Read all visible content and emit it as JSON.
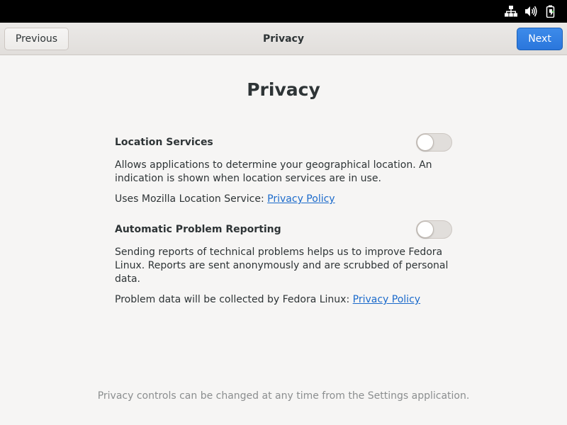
{
  "tray": {
    "icons": [
      "network-wired-icon",
      "volume-icon",
      "battery-charging-icon"
    ]
  },
  "header": {
    "title": "Privacy",
    "previous_label": "Previous",
    "next_label": "Next"
  },
  "main": {
    "title": "Privacy",
    "sections": [
      {
        "label": "Location Services",
        "enabled": false,
        "description": "Allows applications to determine your geographical location. An indication is shown when location services are in use.",
        "policy_prefix": "Uses Mozilla Location Service:",
        "policy_link": "Privacy Policy"
      },
      {
        "label": "Automatic Problem Reporting",
        "enabled": false,
        "description": "Sending reports of technical problems helps us to improve Fedora Linux. Reports are sent anonymously and are scrubbed of personal data.",
        "policy_prefix": "Problem data will be collected by Fedora Linux:",
        "policy_link": "Privacy Policy"
      }
    ],
    "footer": "Privacy controls can be changed at any time from the Settings application."
  },
  "colors": {
    "accent": "#3584e4",
    "link": "#1b6acb",
    "background": "#f6f5f4",
    "topbar": "#000000"
  }
}
